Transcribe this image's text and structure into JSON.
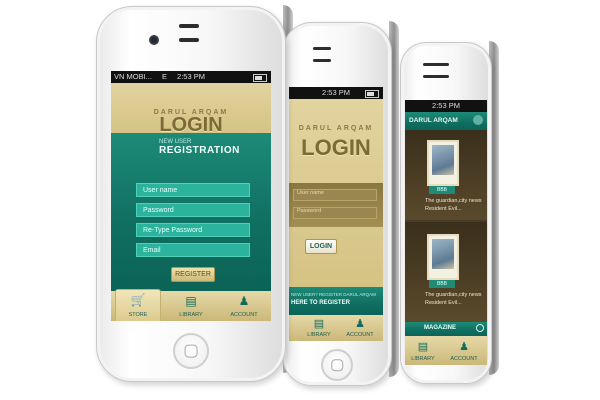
{
  "phone1": {
    "status": {
      "carrier": "VN MOBI...",
      "network": "E",
      "time": "2:53 PM"
    },
    "brand_small": "DARUL ARQAM",
    "title": "LOGIN",
    "new_user": "NEW USER",
    "registration": "REGISTRATION",
    "fields": {
      "username": "User name",
      "password": "Password",
      "retype": "Re-Type Password",
      "email": "Email"
    },
    "register_button": "REGISTER",
    "tabs": {
      "store": "STORE",
      "library": "LIBRARY",
      "account": "ACCOUNT"
    }
  },
  "phone2": {
    "status": {
      "time": "2:53 PM"
    },
    "brand_small": "DARUL ARQAM",
    "title": "LOGIN",
    "fields": {
      "username": "User name",
      "password": "Password"
    },
    "login_button": "LOGIN",
    "register_prompt": "NEW USER? REGISTER DARUL ARQAM",
    "register_link": "HERE TO REGISTER",
    "tabs": {
      "library": "LIBRARY",
      "account": "ACCOUNT"
    }
  },
  "phone3": {
    "status": {
      "time": "2:53 PM"
    },
    "brand": "DARUL ARQAM",
    "items": [
      {
        "caption": "The guardian,city news",
        "subcaption": "Resident Evil...",
        "badge": "BBB"
      },
      {
        "caption": "The guardian,city news",
        "subcaption": "Resident Evil...",
        "badge": "BBB"
      }
    ],
    "section": "MAGAZINE",
    "tabs": {
      "library": "LIBRARY",
      "account": "ACCOUNT"
    }
  },
  "colors": {
    "teal": "#0f6f61",
    "tan": "#d5c384",
    "field": "#2bb39d"
  }
}
